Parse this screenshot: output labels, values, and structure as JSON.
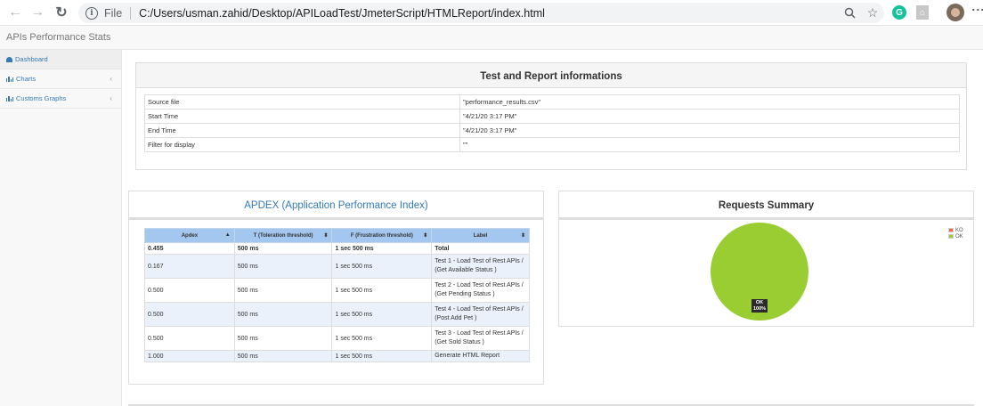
{
  "browser": {
    "file_label": "File",
    "url": "C:/Users/usman.zahid/Desktop/APILoadTest/JmeterScript/HTMLReport/index.html",
    "icons": [
      "back-icon",
      "forward-icon",
      "reload-icon",
      "info-icon",
      "zoom-icon",
      "star-icon",
      "grammarly-extension-icon",
      "pdf-extension-icon",
      "profile-avatar",
      "menu-icon"
    ],
    "grammarly_letter": "G"
  },
  "app": {
    "title": "APIs Performance Stats"
  },
  "sidebar": {
    "items": [
      {
        "label": "Dashboard"
      },
      {
        "label": "Charts"
      },
      {
        "label": "Customs Graphs"
      }
    ]
  },
  "test_info": {
    "title": "Test and Report informations",
    "rows": [
      {
        "key": "Source file",
        "value": "\"performance_results.csv\""
      },
      {
        "key": "Start Time",
        "value": "\"4/21/20 3:17 PM\""
      },
      {
        "key": "End Time",
        "value": "\"4/21/20 3:17 PM\""
      },
      {
        "key": "Filter for display",
        "value": "\"\""
      }
    ]
  },
  "apdex": {
    "title": "APDEX (Application Performance Index)",
    "headers": [
      "Apdex",
      "T (Toleration threshold)",
      "F (Frustration threshold)",
      "Label"
    ],
    "rows": [
      {
        "apdex": "0.455",
        "t": "500 ms",
        "f": "1 sec 500 ms",
        "label": "Total"
      },
      {
        "apdex": "0.167",
        "t": "500 ms",
        "f": "1 sec 500 ms",
        "label": "Test 1 - Load Test of Rest APIs / (Get Available Status )"
      },
      {
        "apdex": "0.500",
        "t": "500 ms",
        "f": "1 sec 500 ms",
        "label": "Test 2 - Load Test of Rest APIs / (Get Pending Status )"
      },
      {
        "apdex": "0.500",
        "t": "500 ms",
        "f": "1 sec 500 ms",
        "label": "Test 4 - Load Test of Rest APIs / (Post Add Pet )"
      },
      {
        "apdex": "0.500",
        "t": "500 ms",
        "f": "1 sec 500 ms",
        "label": "Test 3 - Load Test of Rest APIs / (Get Sold Status )"
      },
      {
        "apdex": "1.000",
        "t": "500 ms",
        "f": "1 sec 500 ms",
        "label": "Generate HTML Report"
      }
    ]
  },
  "requests_summary": {
    "title": "Requests Summary",
    "slice_label_line1": "OK",
    "slice_label_line2": "100%"
  },
  "chart_data": {
    "type": "pie",
    "title": "Requests Summary",
    "categories": [
      "KO",
      "OK"
    ],
    "values": [
      0,
      100
    ],
    "colors": [
      "#ff6347",
      "#9acd32"
    ],
    "legend": "top-right"
  }
}
